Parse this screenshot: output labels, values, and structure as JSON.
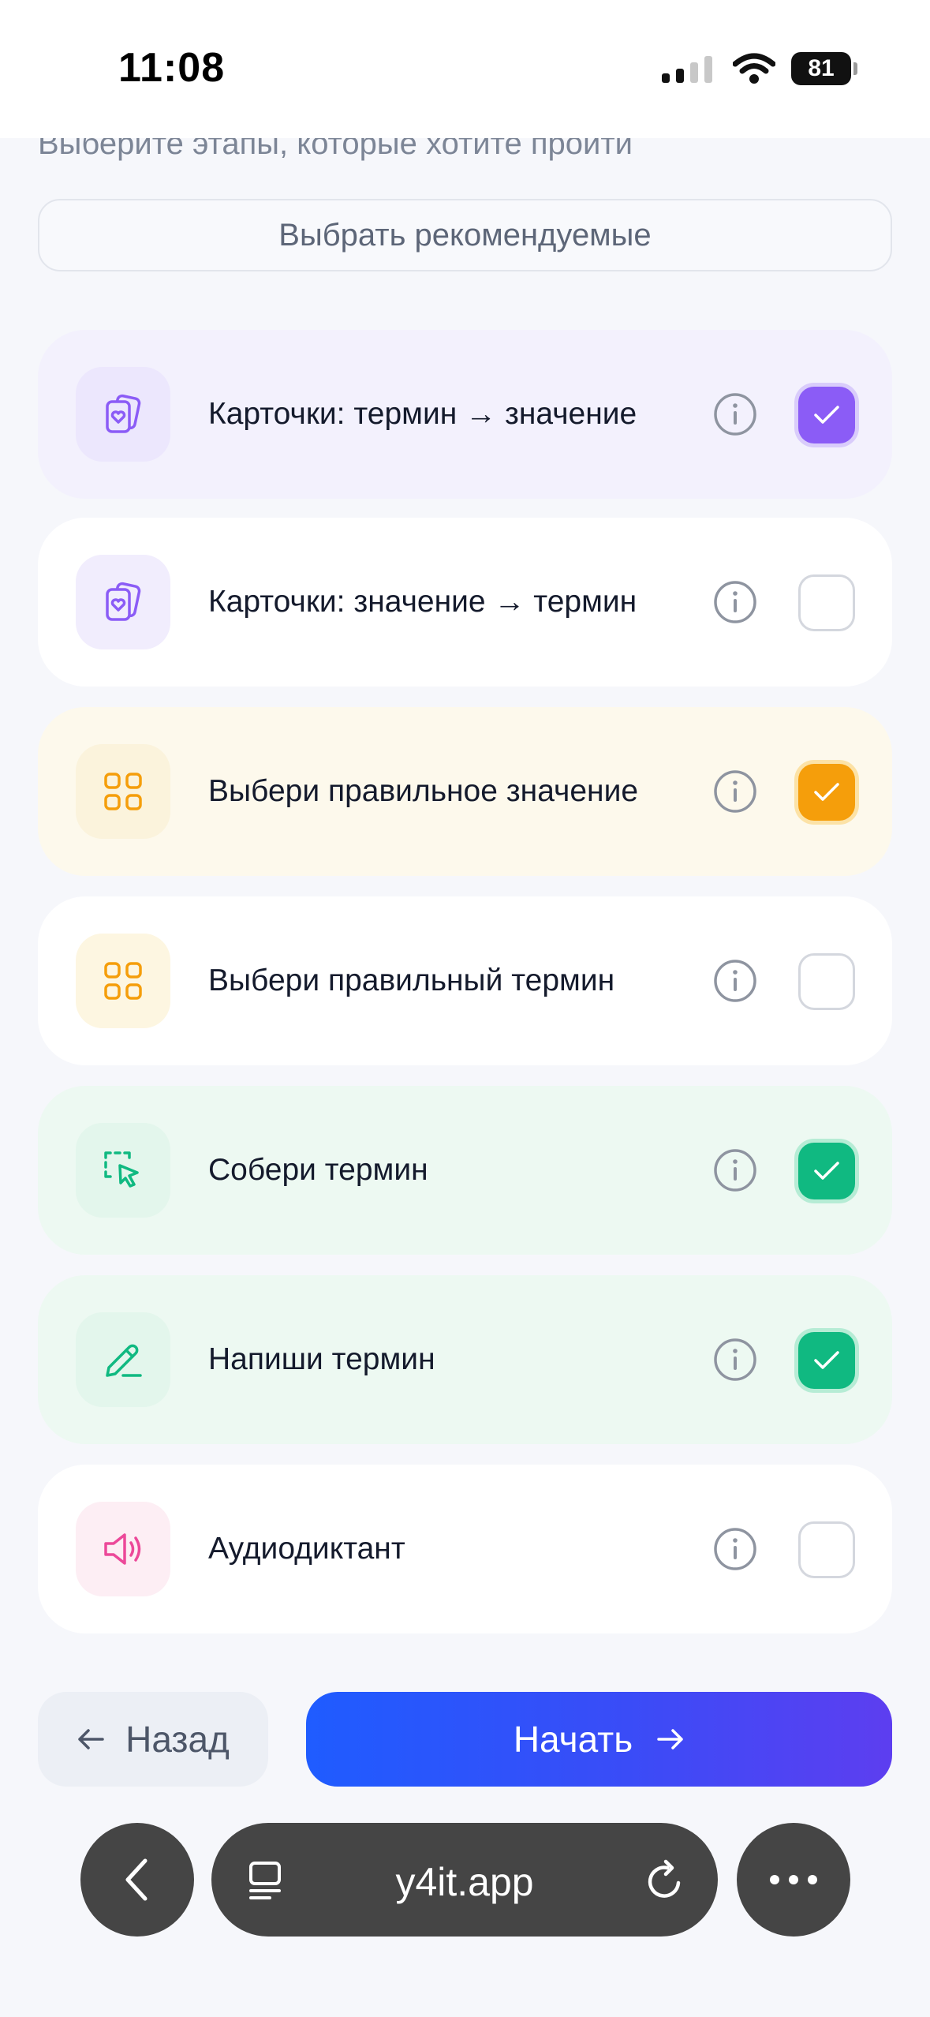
{
  "status_bar": {
    "time": "11:08",
    "battery": "81"
  },
  "intro_text": "Выберите этапы, которые хотите пройти",
  "recommend_button": "Выбрать рекомендуемые",
  "stages": [
    {
      "label": "Карточки: термин → значение",
      "icon": "cards-icon",
      "checked": true,
      "accent": "#8b5cf6"
    },
    {
      "label": "Карточки: значение → термин",
      "icon": "cards-icon",
      "checked": false,
      "accent": "#8b5cf6"
    },
    {
      "label": "Выбери правильное значение",
      "icon": "grid-icon",
      "checked": true,
      "accent": "#f59e0b"
    },
    {
      "label": "Выбери правильный термин",
      "icon": "grid-icon",
      "checked": false,
      "accent": "#f59e0b"
    },
    {
      "label": "Собери термин",
      "icon": "select-cursor-icon",
      "checked": true,
      "accent": "#10b981"
    },
    {
      "label": "Напиши термин",
      "icon": "pencil-icon",
      "checked": true,
      "accent": "#10b981"
    },
    {
      "label": "Аудиодиктант",
      "icon": "speaker-icon",
      "checked": false,
      "accent": "#ec4899"
    }
  ],
  "footer": {
    "back_label": "Назад",
    "start_label": "Начать"
  },
  "browser": {
    "url": "y4it.app"
  }
}
